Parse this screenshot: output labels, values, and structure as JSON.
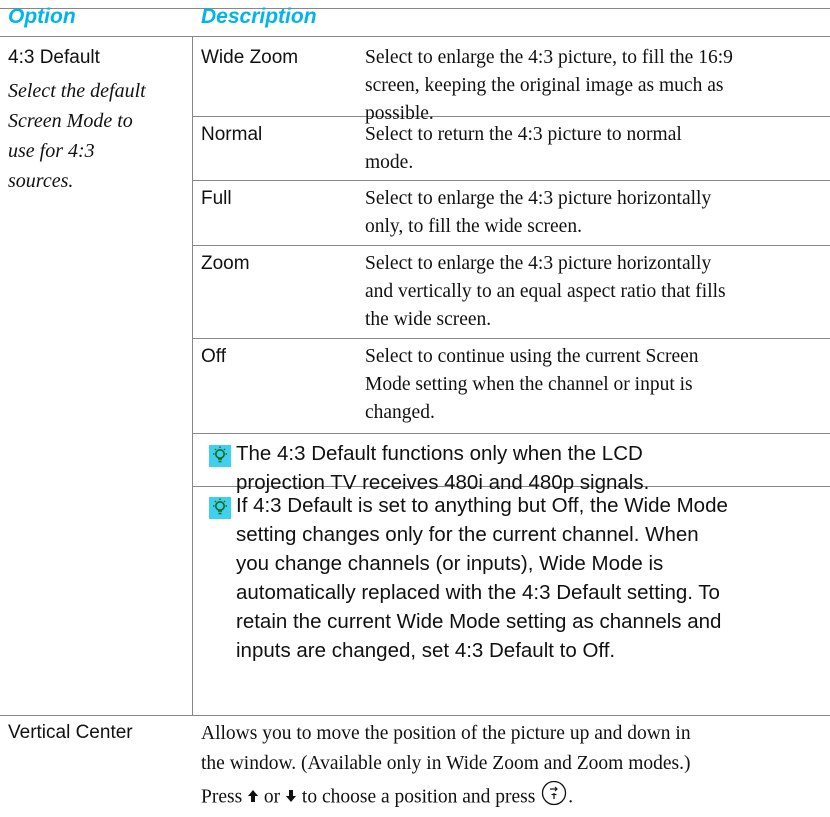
{
  "header": {
    "option": "Option",
    "description": "Description"
  },
  "default_4_3": {
    "label": "4:3 Default",
    "note_lines": [
      "Select the default",
      "Screen Mode to",
      "use for 4:3",
      "sources."
    ],
    "modes": [
      {
        "label": "Wide Zoom",
        "desc_lines": [
          "Select to enlarge the 4:3 picture, to fill the 16:9",
          "screen, keeping the original image as much as",
          "possible."
        ]
      },
      {
        "label": "Normal",
        "desc_lines": [
          "Select to return the 4:3 picture to normal",
          "mode."
        ]
      },
      {
        "label": "Full",
        "desc_lines": [
          "Select to enlarge the 4:3 picture horizontally",
          "only, to fill the wide screen."
        ]
      },
      {
        "label": "Zoom",
        "desc_lines": [
          "Select to enlarge the 4:3 picture horizontally",
          "and vertically to an equal aspect ratio that fills",
          "the wide screen."
        ]
      },
      {
        "label": "Off",
        "desc_lines": [
          "Select to continue using the current Screen",
          "Mode setting when the channel or input is",
          "changed."
        ]
      }
    ],
    "tips": [
      {
        "icon": "lightbulb-tip-icon",
        "lines": [
          "The 4:3 Default functions only when the LCD",
          "projection TV receives 480i and 480p signals."
        ]
      },
      {
        "icon": "lightbulb-tip-icon",
        "lines": [
          "If 4:3 Default is set to anything but Off, the Wide Mode",
          "setting changes only for the current channel. When",
          "you change channels (or inputs), Wide Mode is",
          "automatically replaced with the 4:3 Default setting. To",
          "retain the current Wide Mode setting as channels and",
          "inputs are changed, set 4:3 Default to Off."
        ]
      }
    ]
  },
  "vertical_center": {
    "label": "Vertical Center",
    "desc_lines": [
      "Allows you to move the position of the picture up and down in",
      "the window. (Available only in Wide Zoom and Zoom modes.)"
    ],
    "press_prefix": "Press",
    "press_or": "or",
    "press_suffix": "to choose a position and press",
    "press_end": "."
  },
  "colors": {
    "header_accent": "#00b4ee",
    "tip_icon_bg": "#3fd0f0",
    "rule": "#888888"
  }
}
